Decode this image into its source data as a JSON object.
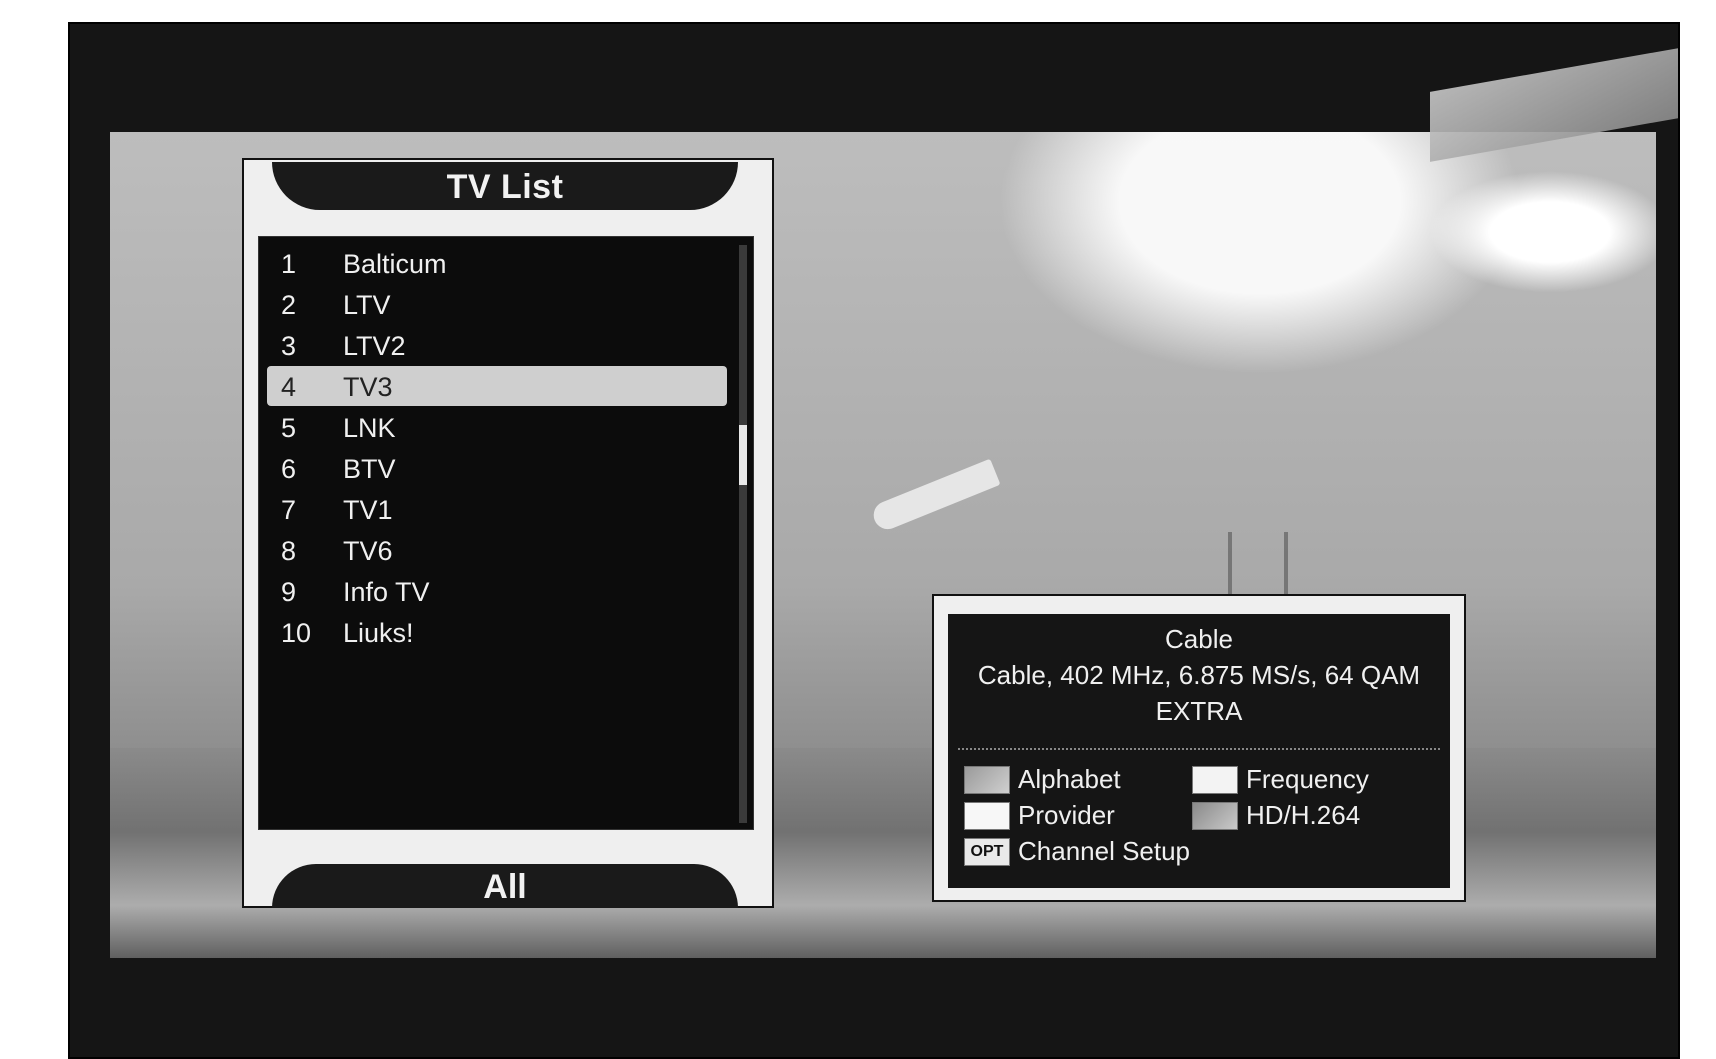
{
  "tv_list": {
    "title": "TV List",
    "footer": "All",
    "channels": [
      {
        "num": "1",
        "name": "Balticum"
      },
      {
        "num": "2",
        "name": "LTV"
      },
      {
        "num": "3",
        "name": "LTV2"
      },
      {
        "num": "4",
        "name": "TV3"
      },
      {
        "num": "5",
        "name": "LNK"
      },
      {
        "num": "6",
        "name": "BTV"
      },
      {
        "num": "7",
        "name": "TV1"
      },
      {
        "num": "8",
        "name": "TV6"
      },
      {
        "num": "9",
        "name": "Info TV"
      },
      {
        "num": "10",
        "name": "Liuks!"
      }
    ],
    "selected_index": 3
  },
  "info": {
    "network": "Cable",
    "tuning": "Cable, 402 MHz, 6.875 MS/s, 64 QAM",
    "package": "EXTRA",
    "legend": [
      {
        "key": "red",
        "label": "Alphabet"
      },
      {
        "key": "green",
        "label": "Frequency"
      },
      {
        "key": "yellow",
        "label": "Provider"
      },
      {
        "key": "blue",
        "label": "HD/H.264"
      },
      {
        "key": "opt",
        "key_text": "OPT",
        "label": "Channel Setup"
      }
    ]
  }
}
